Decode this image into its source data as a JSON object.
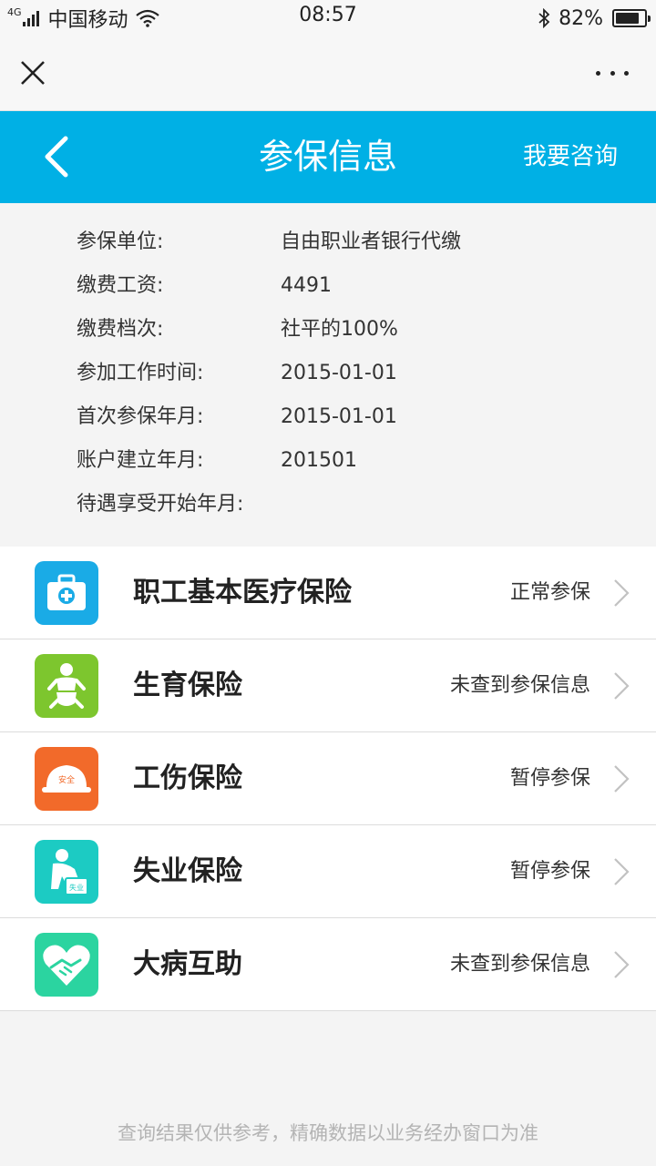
{
  "status_bar": {
    "network": "4G",
    "carrier": "中国移动",
    "time": "08:57",
    "battery": "82%",
    "battery_level": 0.82
  },
  "webview": {
    "close_icon": "close-icon",
    "more_icon": "more-icon"
  },
  "header": {
    "title": "参保信息",
    "consult": "我要咨询",
    "bg_color": "#00b0e5"
  },
  "info": [
    {
      "label": "参保单位:",
      "value": "自由职业者银行代缴"
    },
    {
      "label": "缴费工资:",
      "value": "4491"
    },
    {
      "label": "缴费档次:",
      "value": "社平的100%"
    },
    {
      "label": "参加工作时间:",
      "value": "2015-01-01"
    },
    {
      "label": "首次参保年月:",
      "value": "2015-01-01"
    },
    {
      "label": "账户建立年月:",
      "value": "201501"
    },
    {
      "label": "待遇享受开始年月:",
      "value": ""
    }
  ],
  "insurance": [
    {
      "name": "职工基本医疗保险",
      "status": "正常参保",
      "icon": "medical-kit-icon",
      "color": "#1aabe6"
    },
    {
      "name": "生育保险",
      "status": "未查到参保信息",
      "icon": "baby-icon",
      "color": "#7dc62e"
    },
    {
      "name": "工伤保险",
      "status": "暂停参保",
      "icon": "safety-helmet-icon",
      "color": "#f26a2a",
      "icon_text": "安全"
    },
    {
      "name": "失业保险",
      "status": "暂停参保",
      "icon": "unemployed-person-icon",
      "color": "#1ccbc3",
      "icon_text": "失业"
    },
    {
      "name": "大病互助",
      "status": "未查到参保信息",
      "icon": "heart-handshake-icon",
      "color": "#2bd4a0"
    }
  ],
  "footer": "查询结果仅供参考，精确数据以业务经办窗口为准"
}
